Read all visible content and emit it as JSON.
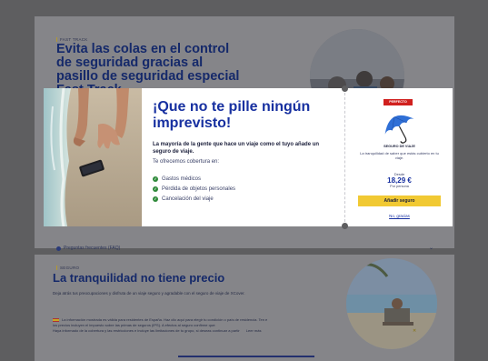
{
  "background": {
    "fast_track": {
      "eyebrow": "FAST TRACK",
      "title": "Evita las colas en el control de seguridad gracias al pasillo de seguridad especial Fast Track"
    },
    "faq": {
      "label": "Preguntas frecuentes (FAQ)"
    },
    "seguro": {
      "eyebrow": "SEGURO",
      "title": "La tranquilidad no tiene precio",
      "subtitle": "Deja atrás tus preocupaciones y disfruta de un viaje seguro y agradable con el seguro de viaje de XCover.",
      "notice_line1": "La información mostrada es válida para residentes de España. Haz clic aquí para elegir tu condición o país de residencia. Ten e",
      "notice_line2": "los precios incluyen el impuesto sobre las primas de seguros (IPS). A efectos al seguro confirme que:",
      "notice_line3": "Haya informado de la cobertura y las restricciones e incluye las limitaciones de tu grupo, si deseas continuar a partir",
      "read_more": "Leer más"
    }
  },
  "modal": {
    "title": "¡Que no te pille ningún imprevisto!",
    "lead": "La mayoría de la gente que hace un viaje como el tuyo añade un seguro de viaje.",
    "coverage_intro": "Te ofrecemos cobertura en:",
    "coverage_items": [
      "Gastos médicos",
      "Pérdida de objetos personales",
      "Cancelación del viaje"
    ],
    "side": {
      "badge": "PERFECTO",
      "product_name": "SEGURO DE VIAJE",
      "description": "La tranquilidad de saber que estás cubierto en tu viaje.",
      "from_label": "Desde",
      "price": "18,29 €",
      "per_label": "Por persona",
      "add_button": "Añadir seguro",
      "decline_link": "No, gracias"
    }
  },
  "colors": {
    "brand_blue": "#1730a0",
    "cta_yellow": "#f1c933",
    "badge_red": "#d0201e",
    "check_green": "#2f8a3a",
    "overlay_gray": "#5e5e60"
  }
}
